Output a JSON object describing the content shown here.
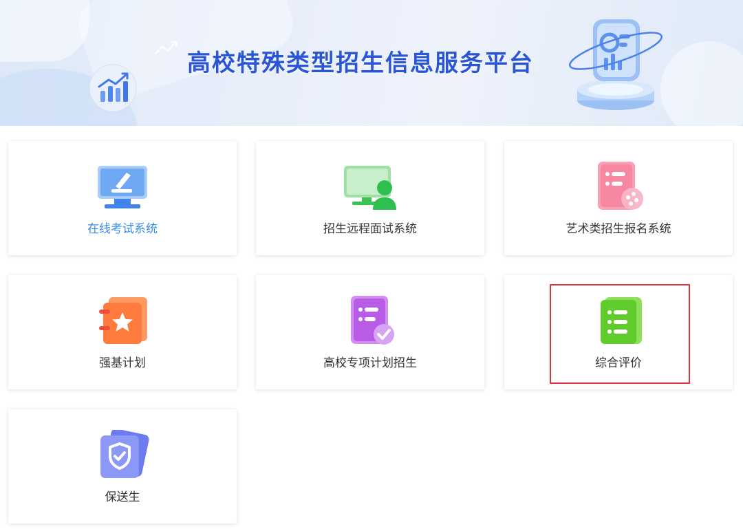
{
  "banner": {
    "title": "高校特殊类型招生信息服务平台"
  },
  "cards": [
    {
      "label": "在线考试系统",
      "icon": "monitor-pen-icon",
      "active": true
    },
    {
      "label": "招生远程面试系统",
      "icon": "remote-interview-icon"
    },
    {
      "label": "艺术类招生报名系统",
      "icon": "art-form-icon"
    },
    {
      "label": "强基计划",
      "icon": "star-notebook-icon"
    },
    {
      "label": "高校专项计划招生",
      "icon": "checklist-icon"
    },
    {
      "label": "综合评价",
      "icon": "list-document-icon",
      "highlighted": true
    },
    {
      "label": "保送生",
      "icon": "shield-check-icon"
    }
  ],
  "colors": {
    "title": "#2a56d6",
    "active_label": "#3a8ee6",
    "highlight_border": "#d9363e"
  }
}
